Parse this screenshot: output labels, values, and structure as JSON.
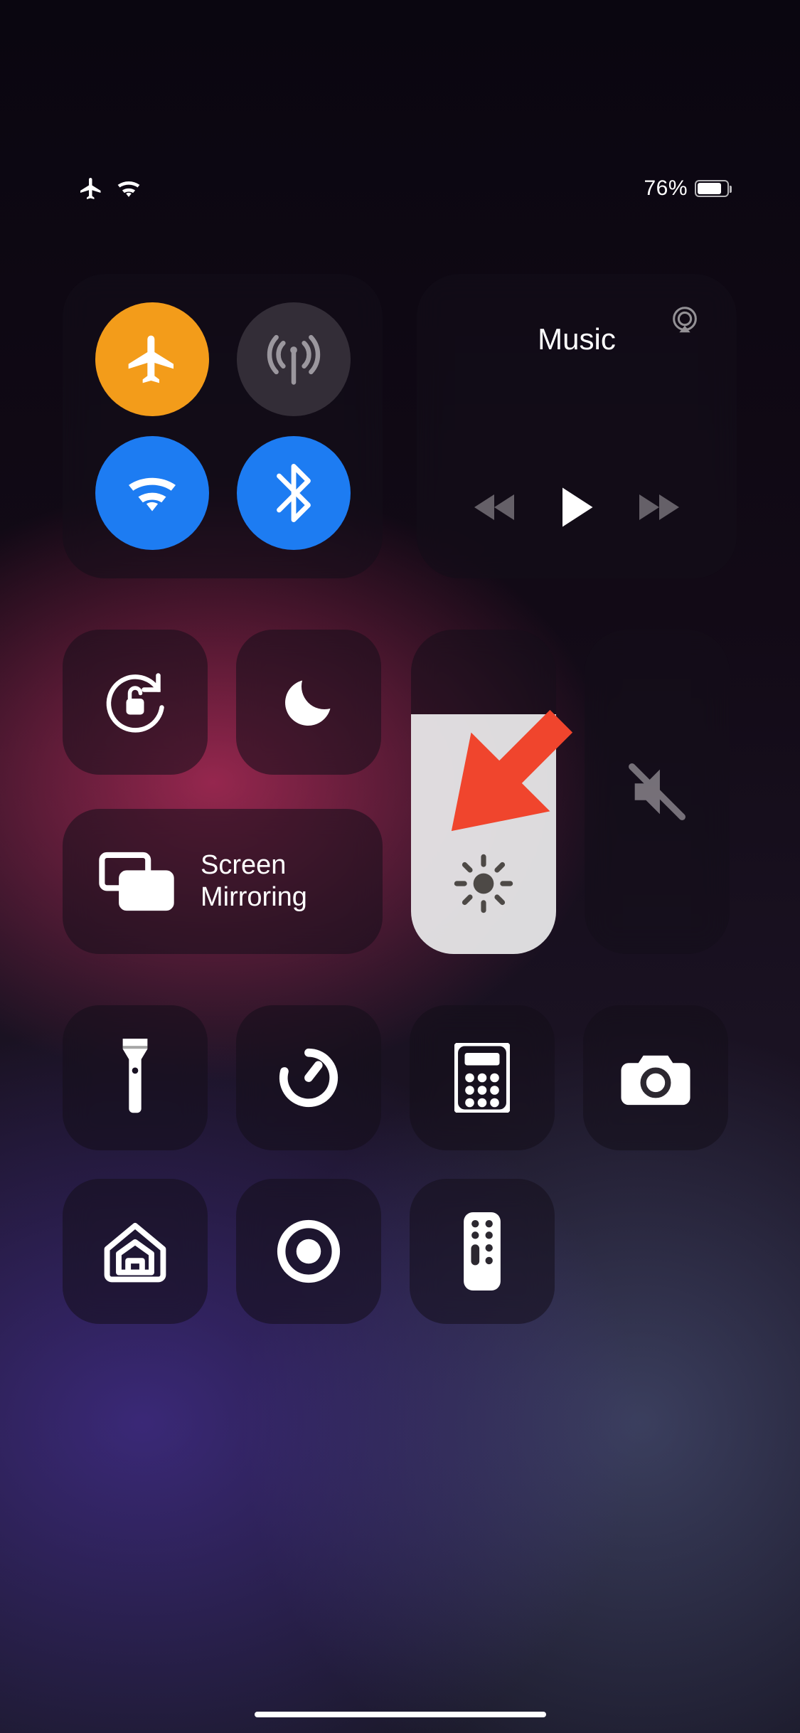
{
  "status_bar": {
    "airplane_mode": true,
    "wifi_connected": true,
    "battery_percent_label": "76%",
    "battery_level": 0.76
  },
  "connectivity": {
    "airplane_mode_on": true,
    "cellular_data_on": false,
    "wifi_on": true,
    "bluetooth_on": true
  },
  "media": {
    "title": "Music"
  },
  "toggles": {
    "orientation_lock_on": false,
    "do_not_disturb_on": false
  },
  "screen_mirroring": {
    "label_line1": "Screen",
    "label_line2": "Mirroring"
  },
  "sliders": {
    "brightness_level": 0.74,
    "volume_level": 0.0,
    "volume_muted": true
  },
  "shortcut_tiles": [
    "flashlight",
    "timer",
    "calculator",
    "camera",
    "home",
    "screen-record",
    "apple-tv-remote"
  ],
  "annotation": {
    "type": "arrow",
    "color": "#f0452d",
    "points_to": "screen-mirroring-tile"
  }
}
